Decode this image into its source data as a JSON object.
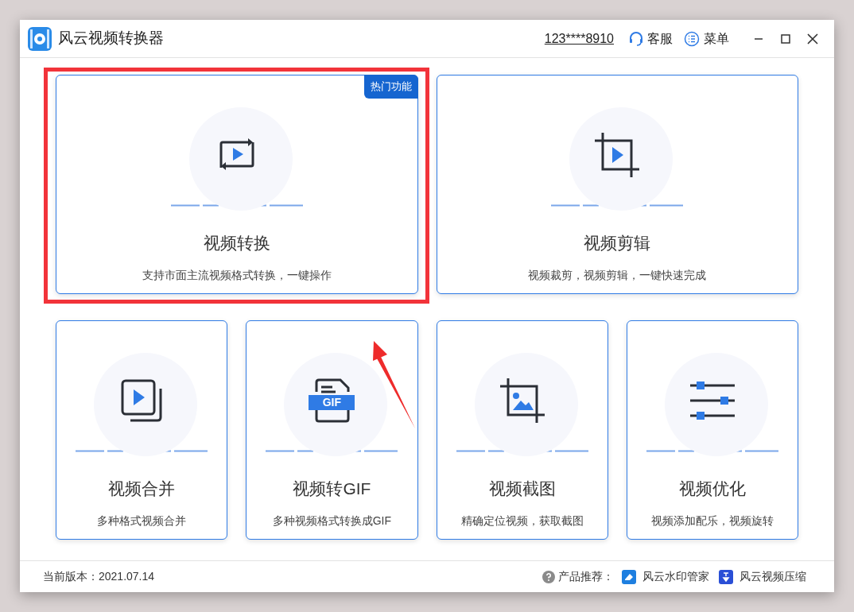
{
  "window": {
    "title": "风云视频转换器"
  },
  "header": {
    "account": "123****8910",
    "service": "客服",
    "menu": "菜单"
  },
  "cards": [
    {
      "kind": "convert",
      "title": "视频转换",
      "description": "支持市面主流视频格式转换，一键操作",
      "badge": "热门功能"
    },
    {
      "kind": "crop",
      "title": "视频剪辑",
      "description": "视频裁剪，视频剪辑，一键快速完成"
    },
    {
      "kind": "merge",
      "title": "视频合并",
      "description": "多种格式视频合并"
    },
    {
      "kind": "gif",
      "icon_label": "GIF",
      "title": "视频转GIF",
      "description": "多种视频格式转换成GIF"
    },
    {
      "kind": "screenshot",
      "title": "视频截图",
      "description": "精确定位视频，获取截图"
    },
    {
      "kind": "optimize",
      "title": "视频优化",
      "description": "视频添加配乐，视频旋转"
    }
  ],
  "footer": {
    "version": "当前版本：2021.07.14",
    "recommend_label": "产品推荐：",
    "products": [
      {
        "kind": "watermark",
        "name": "风云水印管家"
      },
      {
        "kind": "compress",
        "name": "风云视频压缩"
      }
    ]
  }
}
